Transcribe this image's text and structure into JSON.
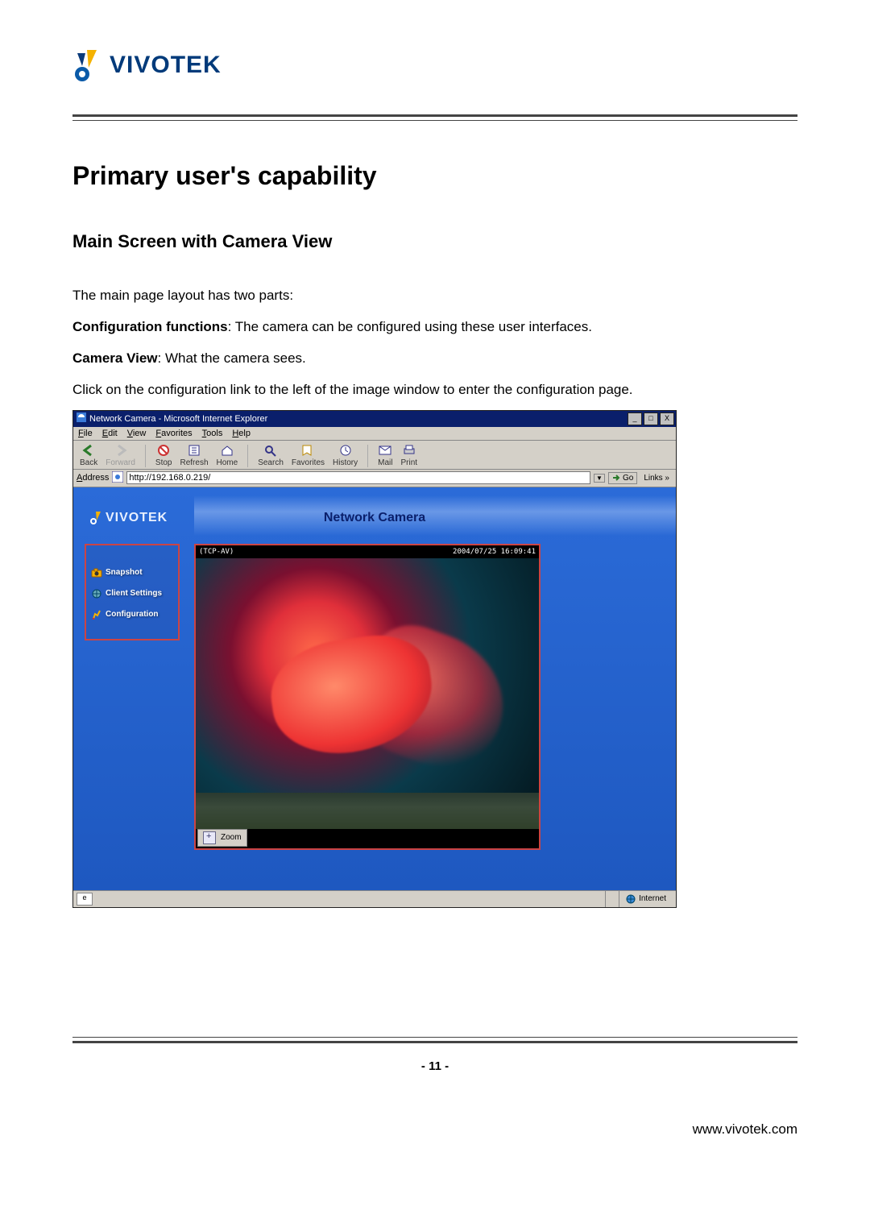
{
  "header": {
    "brand": "VIVOTEK"
  },
  "headings": {
    "h1": "Primary user's capability",
    "h2": "Main Screen with Camera View"
  },
  "paragraphs": {
    "p1": "The main page layout has two parts:",
    "p2_bold": "Configuration functions",
    "p2_rest": ": The camera can be configured using these user interfaces.",
    "p3_bold": "Camera View",
    "p3_rest": ": What the camera sees.",
    "p4": "Click on the configuration link to the left of the image window to enter the configuration page."
  },
  "browser": {
    "title": "Network Camera - Microsoft Internet Explorer",
    "window_buttons": {
      "min": "_",
      "max": "□",
      "close": "X"
    },
    "menu": [
      "File",
      "Edit",
      "View",
      "Favorites",
      "Tools",
      "Help"
    ],
    "toolbar": {
      "back": "Back",
      "forward": "Forward",
      "stop": "Stop",
      "refresh": "Refresh",
      "home": "Home",
      "search": "Search",
      "favorites": "Favorites",
      "history": "History",
      "mail": "Mail",
      "print": "Print"
    },
    "address_label": "Address",
    "address_value": "http://192.168.0.219/",
    "go_label": "Go",
    "links_label": "Links »",
    "status": {
      "zone": "Internet"
    }
  },
  "camera_page": {
    "brand": "VIVOTEK",
    "title": "Network Camera",
    "sidebar": {
      "snapshot": "Snapshot",
      "client_settings": "Client Settings",
      "configuration": "Configuration"
    },
    "video": {
      "left_label": "(TCP-AV)",
      "timestamp": "2004/07/25 16:09:41",
      "zoom_label": "Zoom"
    }
  },
  "footer": {
    "page_number": "- 11 -",
    "url": "www.vivotek.com"
  }
}
